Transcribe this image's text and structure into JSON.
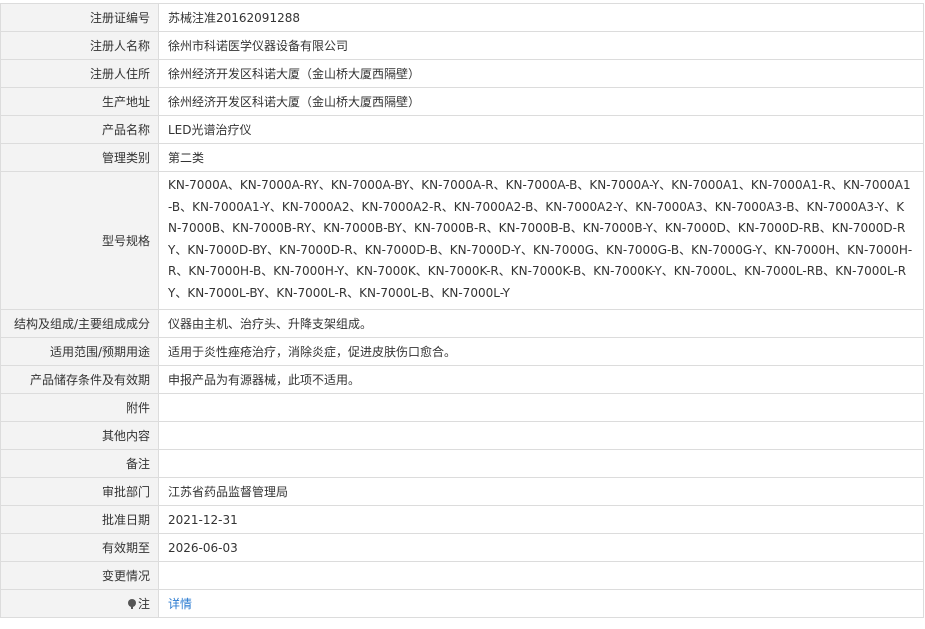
{
  "rows": {
    "reg_no": {
      "label": "注册证编号",
      "value": "苏械注准20162091288"
    },
    "registrant": {
      "label": "注册人名称",
      "value": "徐州市科诺医学仪器设备有限公司"
    },
    "residence": {
      "label": "注册人住所",
      "value": "徐州经济开发区科诺大厦（金山桥大厦西隔壁）"
    },
    "production_address": {
      "label": "生产地址",
      "value": "徐州经济开发区科诺大厦（金山桥大厦西隔壁）"
    },
    "product_name": {
      "label": "产品名称",
      "value": "LED光谱治疗仪"
    },
    "category": {
      "label": "管理类别",
      "value": "第二类"
    },
    "models": {
      "label": "型号规格",
      "value": "KN-7000A、KN-7000A-RY、KN-7000A-BY、KN-7000A-R、KN-7000A-B、KN-7000A-Y、KN-7000A1、KN-7000A1-R、KN-7000A1-B、KN-7000A1-Y、KN-7000A2、KN-7000A2-R、KN-7000A2-B、KN-7000A2-Y、KN-7000A3、KN-7000A3-B、KN-7000A3-Y、KN-7000B、KN-7000B-RY、KN-7000B-BY、KN-7000B-R、KN-7000B-B、KN-7000B-Y、KN-7000D、KN-7000D-RB、KN-7000D-RY、KN-7000D-BY、KN-7000D-R、KN-7000D-B、KN-7000D-Y、KN-7000G、KN-7000G-B、KN-7000G-Y、KN-7000H、KN-7000H-R、KN-7000H-B、KN-7000H-Y、KN-7000K、KN-7000K-R、KN-7000K-B、KN-7000K-Y、KN-7000L、KN-7000L-RB、KN-7000L-RY、KN-7000L-BY、KN-7000L-R、KN-7000L-B、KN-7000L-Y"
    },
    "structure": {
      "label": "结构及组成/主要组成成分",
      "value": "仪器由主机、治疗头、升降支架组成。"
    },
    "scope": {
      "label": "适用范围/预期用途",
      "value": "适用于炎性痤疮治疗，消除炎症，促进皮肤伤口愈合。"
    },
    "storage": {
      "label": "产品储存条件及有效期",
      "value": "申报产品为有源器械，此项不适用。"
    },
    "attachment": {
      "label": "附件",
      "value": ""
    },
    "other": {
      "label": "其他内容",
      "value": ""
    },
    "remarks": {
      "label": "备注",
      "value": ""
    },
    "approval_dept": {
      "label": "审批部门",
      "value": "江苏省药品监督管理局"
    },
    "approval_date": {
      "label": "批准日期",
      "value": "2021-12-31"
    },
    "valid_until": {
      "label": "有效期至",
      "value": "2026-06-03"
    },
    "changes": {
      "label": "变更情况",
      "value": ""
    },
    "note": {
      "label": "注",
      "link": "详情",
      "icon": "lightbulb-icon"
    }
  },
  "colors": {
    "label_bg": "#f3f3f3",
    "border": "#dcdcdc",
    "link": "#2a7bd1"
  }
}
